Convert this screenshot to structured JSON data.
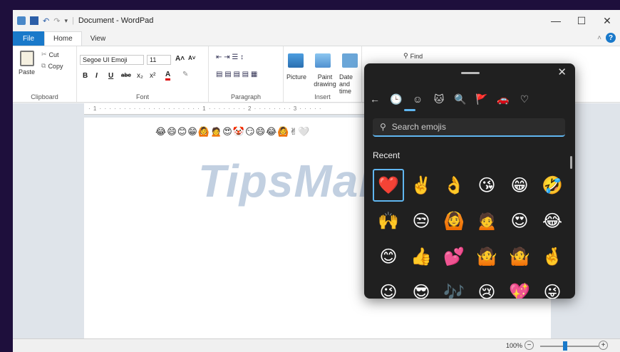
{
  "window": {
    "title": "Document - WordPad",
    "controls": {
      "minimize": "—",
      "maximize": "☐",
      "close": "✕"
    }
  },
  "tabs": {
    "file": "File",
    "home": "Home",
    "view": "View"
  },
  "ribbon": {
    "clipboard": {
      "label": "Clipboard",
      "paste": "Paste",
      "cut": "Cut",
      "copy": "Copy"
    },
    "font": {
      "label": "Font",
      "family": "Segoe UI Emoji",
      "size": "11",
      "bold": "B",
      "italic": "I",
      "underline": "U",
      "strike": "abc",
      "sub": "x₂",
      "sup": "x²",
      "grow": "A˄",
      "shrink": "A˅"
    },
    "paragraph": {
      "label": "Paragraph"
    },
    "insert": {
      "label": "Insert",
      "picture": "Picture",
      "paint": "Paint drawing",
      "datetime": "Date and time",
      "find": "Find"
    }
  },
  "ruler": {
    "marks": "· 1 · · · · · · · · · · · · · · · · · · · · · 1 · · · · · · · · 2 · · · · · · · · 3 · · · · ·"
  },
  "document": {
    "text": "😂😄😊😁🙆🙍😍🤡😏😄😂🙆✌🤍"
  },
  "watermark": {
    "text": "TipsMake"
  },
  "status": {
    "zoom": "100%",
    "zoom_minus": "−",
    "zoom_plus": "+"
  },
  "emoji_panel": {
    "close": "✕",
    "search_placeholder": "Search emojis",
    "section": "Recent",
    "nav": [
      "←",
      "🕒",
      "☺",
      "🐱",
      "🔍",
      "🚩",
      "🚗",
      "♡"
    ],
    "emojis": [
      "❤️",
      "✌️",
      "👌",
      "😘",
      "😁",
      "🤣",
      "🙌",
      "😒",
      "🙆",
      "🙍",
      "😍",
      "😂",
      "😊",
      "👍",
      "💕",
      "🤷",
      "🤷",
      "🤞",
      "😉",
      "😎",
      "🎶",
      "😢",
      "💖",
      "😜"
    ]
  }
}
